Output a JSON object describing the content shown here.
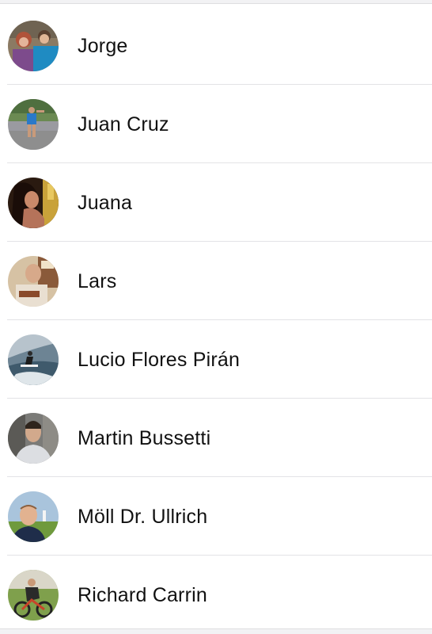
{
  "contacts": [
    {
      "name": "Jorge"
    },
    {
      "name": "Juan Cruz"
    },
    {
      "name": "Juana"
    },
    {
      "name": "Lars"
    },
    {
      "name": "Lucio Flores Pirán"
    },
    {
      "name": "Martin Bussetti"
    },
    {
      "name": "Möll Dr. Ullrich"
    },
    {
      "name": "Richard Carrin"
    }
  ]
}
